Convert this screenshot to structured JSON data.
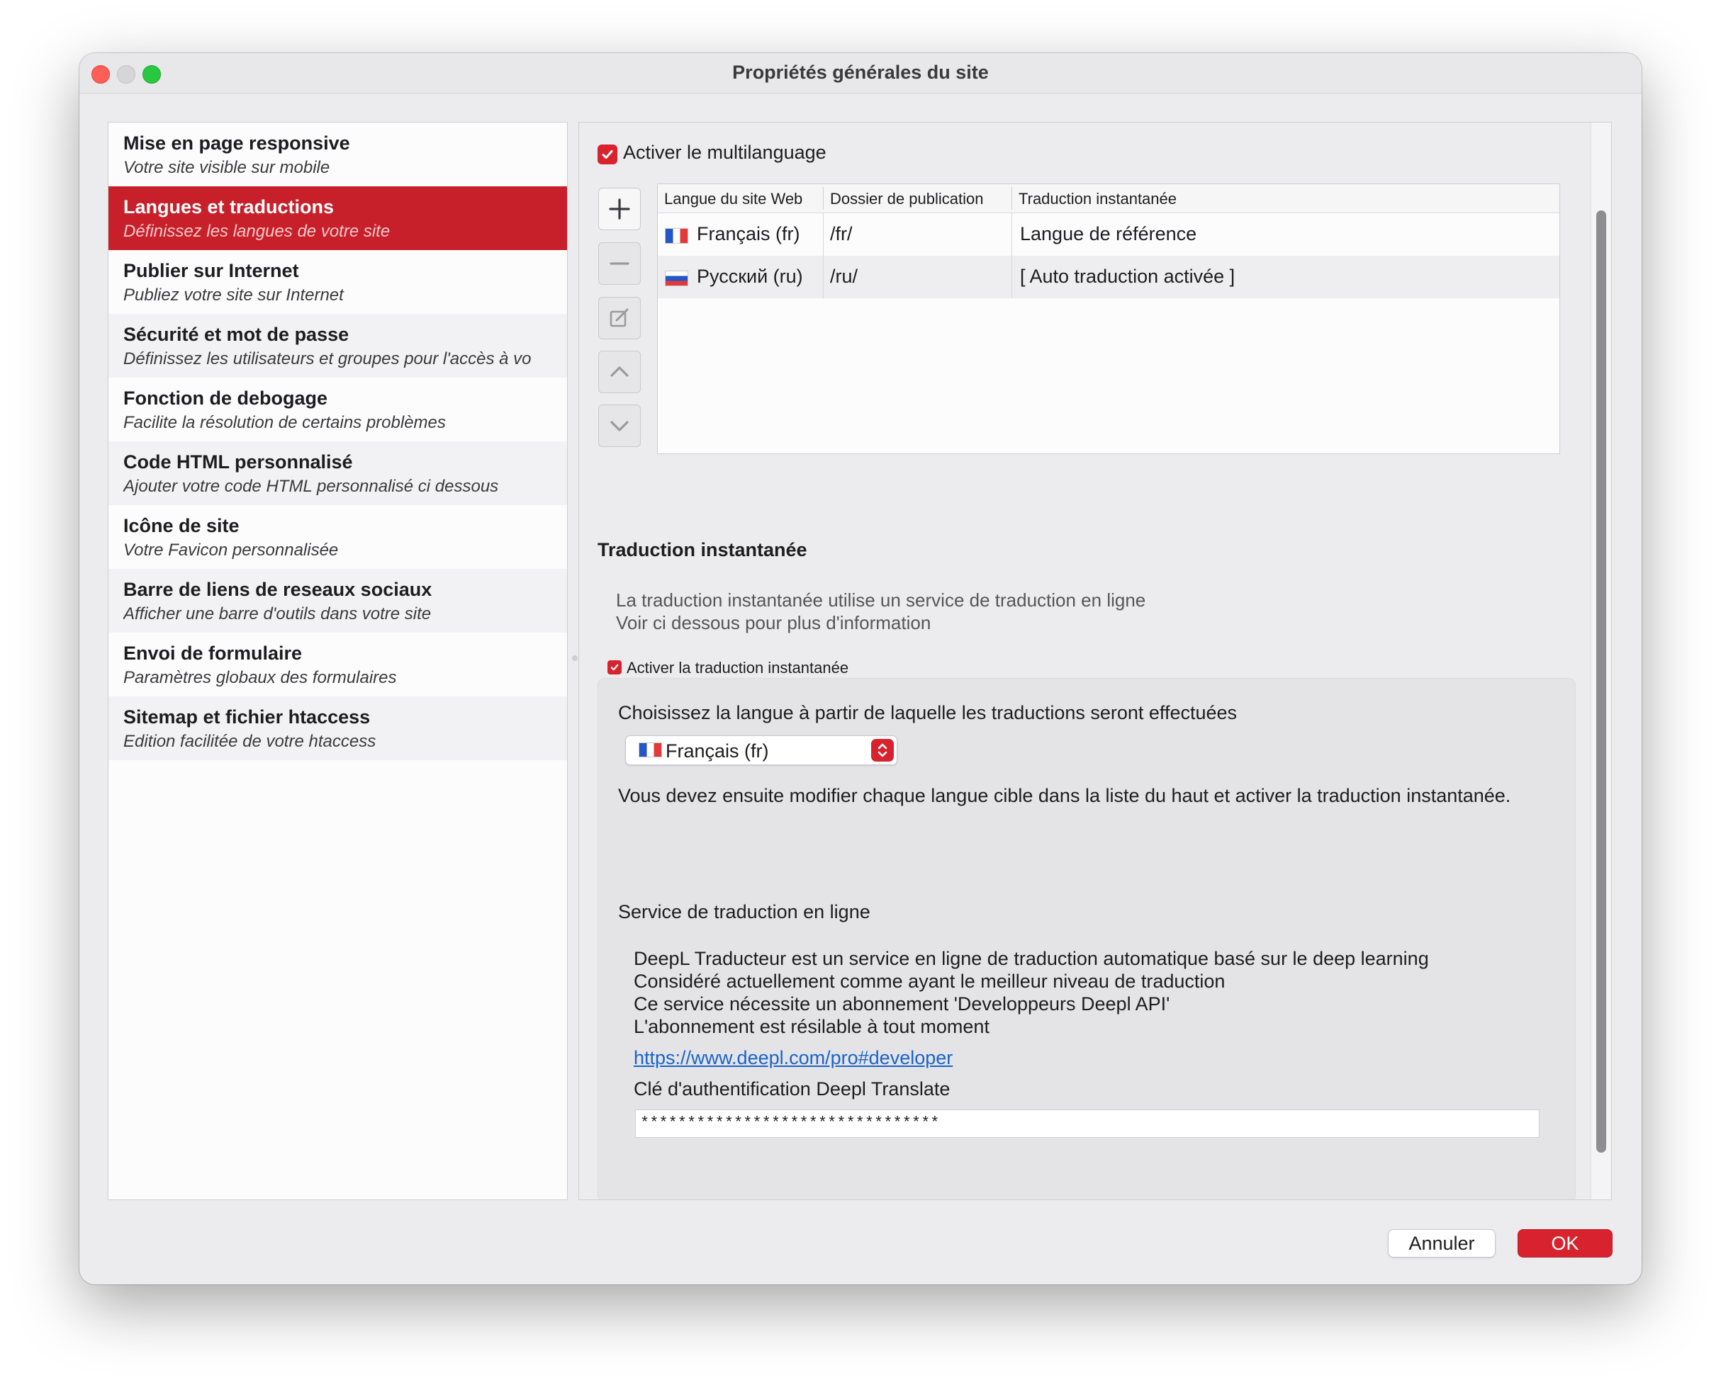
{
  "window": {
    "title": "Propriétés générales du site"
  },
  "sidebar": {
    "items": [
      {
        "title": "Mise en page responsive",
        "subtitle": "Votre site visible sur mobile"
      },
      {
        "title": "Langues et traductions",
        "subtitle": "Définissez les langues de votre site",
        "selected": true
      },
      {
        "title": "Publier sur Internet",
        "subtitle": "Publiez votre site sur Internet"
      },
      {
        "title": "Sécurité et mot de passe",
        "subtitle": "Définissez les utilisateurs et groupes pour l'accès à vo"
      },
      {
        "title": "Fonction de debogage",
        "subtitle": "Facilite la résolution de certains problèmes"
      },
      {
        "title": "Code HTML personnalisé",
        "subtitle": "Ajouter votre code HTML personnalisé ci dessous"
      },
      {
        "title": "Icône de site",
        "subtitle": "Votre Favicon personnalisée"
      },
      {
        "title": "Barre de liens de reseaux sociaux",
        "subtitle": "Afficher une barre d'outils dans votre site"
      },
      {
        "title": "Envoi de formulaire",
        "subtitle": "Paramètres globaux des formulaires"
      },
      {
        "title": "Sitemap et fichier htaccess",
        "subtitle": "Edition facilitée de votre htaccess"
      }
    ]
  },
  "multilang": {
    "checkbox_label": "Activer le multilanguage",
    "checked": true,
    "buttons": [
      "plus-icon",
      "minus-icon",
      "edit-icon",
      "chevron-up-icon",
      "chevron-down-icon"
    ],
    "table": {
      "headers": [
        "Langue du site Web",
        "Dossier de publication",
        "Traduction instantanée"
      ],
      "rows": [
        {
          "flag": "fr",
          "language": "Français (fr)",
          "folder": "/fr/",
          "translation": "Langue de référence"
        },
        {
          "flag": "ru",
          "language": "Русский (ru)",
          "folder": "/ru/",
          "translation": "[ Auto traduction activée ]"
        }
      ]
    }
  },
  "instant": {
    "section_title": "Traduction instantanée",
    "desc_line1": "La traduction instantanée utilise un service de traduction en ligne",
    "desc_line2": "Voir ci dessous pour plus d'information",
    "checkbox_label": "Activer la traduction instantanée",
    "checked": true,
    "choose_label": "Choisissez la langue à partir de laquelle les traductions seront effectuées",
    "source_language": "Français (fr)",
    "note": "Vous devez ensuite modifier chaque langue cible dans la liste du haut et activer la traduction instantanée.",
    "service_title": "Service de traduction en ligne",
    "service_lines": [
      "DeepL Traducteur est un service en ligne de traduction automatique basé sur le deep learning",
      "Considéré actuellement comme ayant le meilleur niveau de traduction",
      "Ce service nécessite un abonnement 'Developpeurs Deepl API'",
      "L'abonnement est résilable à tout moment"
    ],
    "link": "https://www.deepl.com/pro#developer",
    "key_label": "Clé d'authentification Deepl Translate",
    "key_value": "********************************"
  },
  "footer": {
    "cancel_label": "Annuler",
    "ok_label": "OK"
  },
  "colors": {
    "accent": "#d8232f",
    "selected_row": "#c8202b",
    "link": "#1a64c8"
  }
}
